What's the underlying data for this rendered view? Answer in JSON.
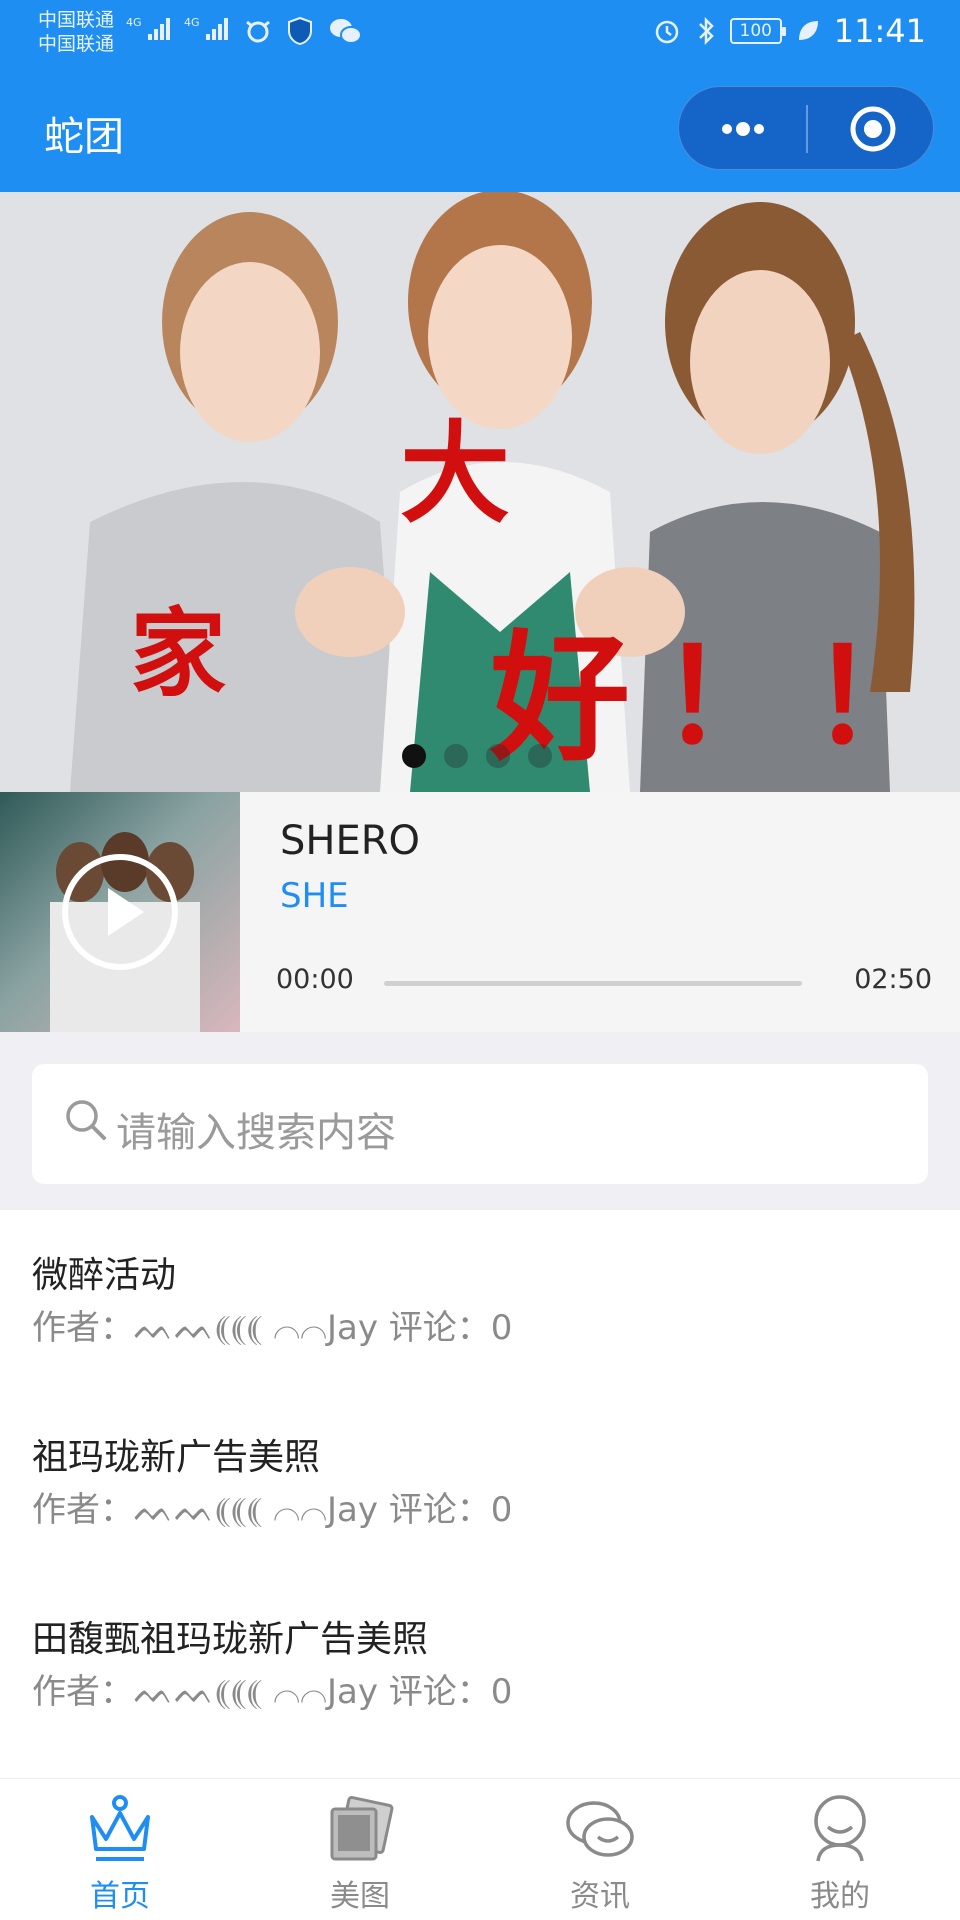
{
  "status_bar": {
    "carrier_1": "中国联通",
    "carrier_2": "中国联通",
    "network_1": "4G",
    "network_2": "4G",
    "battery": "100",
    "time": "11:41"
  },
  "nav": {
    "title": "蛇团",
    "accent": "#1f8ef3"
  },
  "banner": {
    "caption_chars": [
      "大",
      "家",
      "好",
      "！",
      "！"
    ],
    "slide_count": 4,
    "active_slide": 1
  },
  "player": {
    "song_title": "SHERO",
    "artist": "SHE",
    "time_current": "00:00",
    "time_total": "02:50",
    "progress": 0
  },
  "search": {
    "placeholder": "请输入搜索内容"
  },
  "posts": [
    {
      "title": "微醉活动",
      "meta": "作者：ᨓᨓ⸨⸨⸨ ⌒⌒Jay 评论：0"
    },
    {
      "title": "祖玛珑新广告美照",
      "meta": "作者：ᨓᨓ⸨⸨⸨ ⌒⌒Jay 评论：0"
    },
    {
      "title": "田馥甄祖玛珑新广告美照",
      "meta": "作者：ᨓᨓ⸨⸨⸨ ⌒⌒Jay 评论：0"
    }
  ],
  "tabs": [
    {
      "label": "首页",
      "icon": "crown-icon",
      "active": true
    },
    {
      "label": "美图",
      "icon": "photos-icon",
      "active": false
    },
    {
      "label": "资讯",
      "icon": "chat-icon",
      "active": false
    },
    {
      "label": "我的",
      "icon": "user-icon",
      "active": false
    }
  ]
}
